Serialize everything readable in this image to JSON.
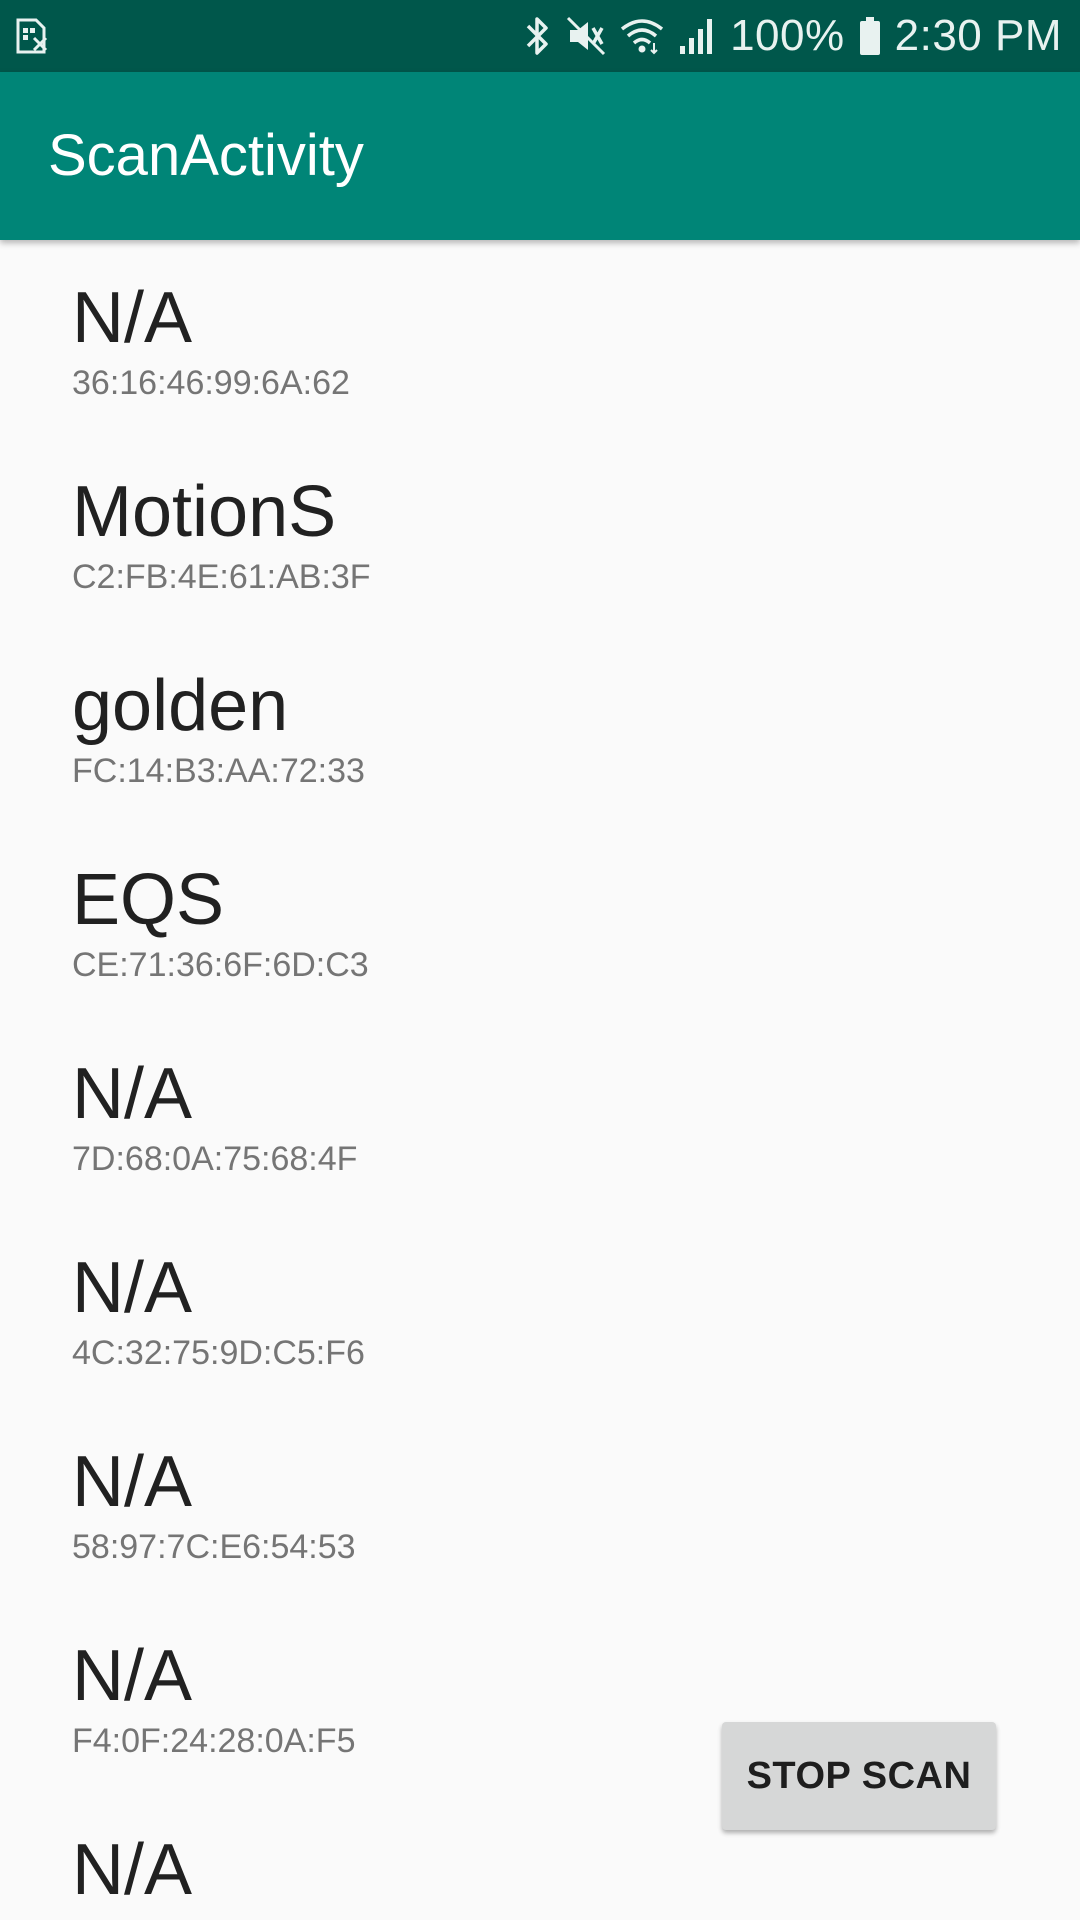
{
  "status_bar": {
    "left_icon": "sim-card-icon",
    "icons": [
      "bluetooth-icon",
      "vibrate-mute-icon",
      "wifi-icon",
      "signal-icon",
      "battery-icon"
    ],
    "battery_percent": "100%",
    "time": "2:30 PM"
  },
  "app_bar": {
    "title": "ScanActivity"
  },
  "devices": [
    {
      "name": "N/A",
      "address": "36:16:46:99:6A:62"
    },
    {
      "name": "MotionS",
      "address": "C2:FB:4E:61:AB:3F"
    },
    {
      "name": "golden",
      "address": "FC:14:B3:AA:72:33"
    },
    {
      "name": "EQS",
      "address": "CE:71:36:6F:6D:C3"
    },
    {
      "name": "N/A",
      "address": "7D:68:0A:75:68:4F"
    },
    {
      "name": "N/A",
      "address": "4C:32:75:9D:C5:F6"
    },
    {
      "name": "N/A",
      "address": "58:97:7C:E6:54:53"
    },
    {
      "name": "N/A",
      "address": "F4:0F:24:28:0A:F5"
    },
    {
      "name": "N/A",
      "address": ""
    }
  ],
  "stop_scan_button": {
    "label": "STOP SCAN"
  },
  "colors": {
    "status_bar": "#00574b",
    "app_bar": "#008577",
    "background": "#fafafa",
    "button": "#d6d7d7"
  }
}
